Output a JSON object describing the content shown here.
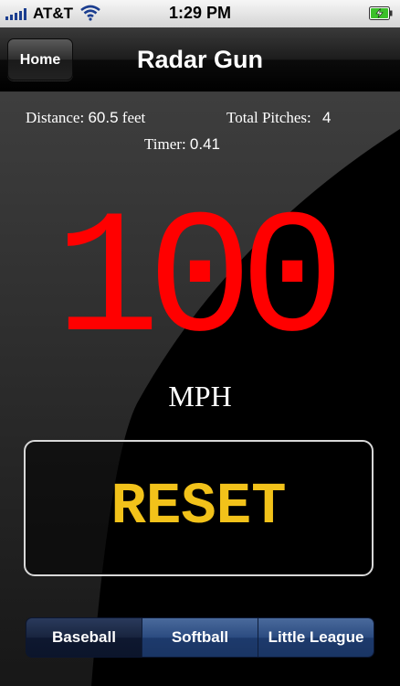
{
  "status_bar": {
    "carrier": "AT&T",
    "time": "1:29 PM",
    "signal_icon": "signal-bars-icon",
    "wifi_icon": "wifi-icon",
    "battery_icon": "battery-charging-icon"
  },
  "nav": {
    "home_label": "Home",
    "title": "Radar Gun"
  },
  "stats": {
    "distance_label": "Distance:",
    "distance_value": "60.5",
    "distance_unit": "feet",
    "pitches_label": "Total Pitches:",
    "pitches_value": "4",
    "timer_label": "Timer:",
    "timer_value": "0.41"
  },
  "readout": {
    "speed": "100",
    "unit": "MPH"
  },
  "reset_label": "RESET",
  "modes": {
    "items": [
      "Baseball",
      "Softball",
      "Little League"
    ],
    "selected": "Baseball"
  },
  "colors": {
    "speed": "#ff0000",
    "reset_text": "#f2c21a",
    "segment_blue": "#2b4b80"
  }
}
